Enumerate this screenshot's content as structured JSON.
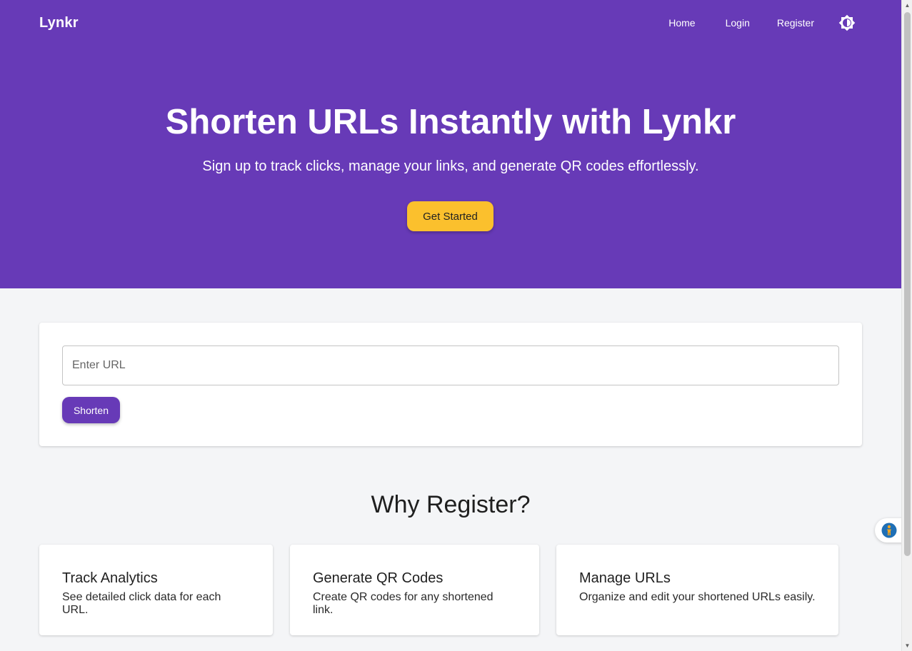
{
  "header": {
    "brand": "Lynkr",
    "nav": {
      "home": "Home",
      "login": "Login",
      "register": "Register"
    },
    "theme_icon": "brightness-contrast-icon"
  },
  "hero": {
    "title": "Shorten URLs Instantly with Lynkr",
    "subtitle": "Sign up to track clicks, manage your links, and generate QR codes effortlessly.",
    "cta_label": "Get Started"
  },
  "shortener": {
    "input_placeholder": "Enter URL",
    "input_value": "",
    "button_label": "Shorten"
  },
  "why": {
    "title": "Why Register?",
    "features": [
      {
        "title": "Track Analytics",
        "description": "See detailed click data for each URL."
      },
      {
        "title": "Generate QR Codes",
        "description": "Create QR codes for any shortened link."
      },
      {
        "title": "Manage URLs",
        "description": "Organize and edit your shortened URLs easily."
      }
    ]
  },
  "floating_widget_icon": "accessibility-person-icon",
  "colors": {
    "primary": "#673ab7",
    "accent": "#fbc02d",
    "background": "#f4f5f7",
    "card": "#ffffff"
  }
}
